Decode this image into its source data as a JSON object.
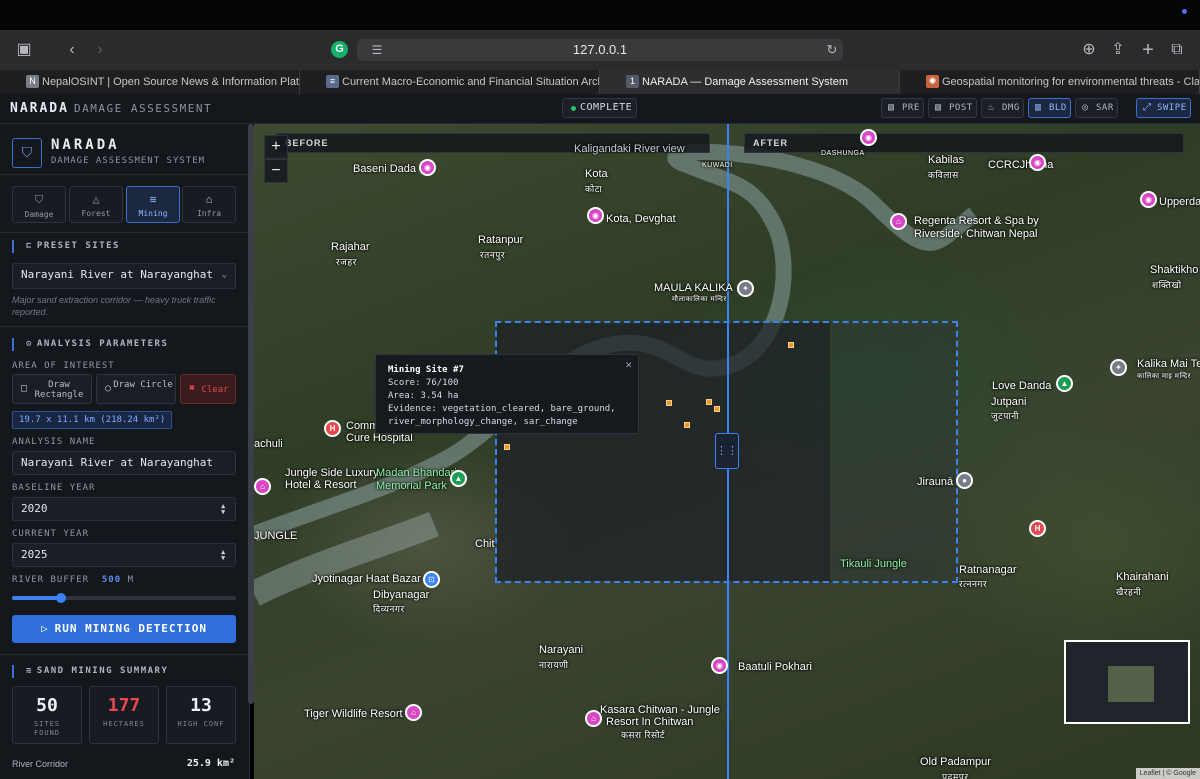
{
  "browser": {
    "url": "127.0.0.1",
    "grammarly_letter": "G",
    "tabs": [
      {
        "fav": "N",
        "title": "NepalOSINT | Open Source News & Information Platform",
        "color": "#777d86"
      },
      {
        "fav": "≡",
        "title": "Current Macro-Economic and Financial Situation Archives - th...",
        "color": "#5a6b8c"
      },
      {
        "fav": "1",
        "title": "NARADA — Damage Assessment System",
        "color": "#555b66"
      },
      {
        "fav": "✺",
        "title": "Geospatial monitoring for environmental threats - Claude",
        "color": "#c96442"
      }
    ]
  },
  "header": {
    "brand": "NARADA",
    "subtitle": "DAMAGE ASSESSMENT",
    "status": "COMPLETE",
    "layers": [
      "PRE",
      "POST",
      "DMG",
      "BLD",
      "SAR"
    ],
    "active_layer": "BLD",
    "swipe": "SWIPE"
  },
  "sidebar": {
    "title": "NARADA",
    "subtitle": "DAMAGE ASSESSMENT SYSTEM",
    "modes": [
      "Damage",
      "Forest",
      "Mining",
      "Infra"
    ],
    "active_mode": "Mining",
    "preset_title": "PRESET SITES",
    "preset_value": "Narayani River at Narayanghat",
    "preset_desc": "Major sand extraction corridor — heavy truck traffic reported.",
    "params_title": "ANALYSIS PARAMETERS",
    "aoi_label": "AREA OF INTEREST",
    "draw_rect": "Draw Rectangle",
    "draw_circle": "Draw Circle",
    "clear": "Clear",
    "aoi_size": "19.7 x 11.1 km (218.24 km²)",
    "name_label": "ANALYSIS NAME",
    "name_value": "Narayani River at Narayanghat",
    "baseline_label": "BASELINE YEAR",
    "baseline_value": "2020",
    "current_label": "CURRENT YEAR",
    "current_value": "2025",
    "buffer_label": "RIVER BUFFER",
    "buffer_value": "500",
    "buffer_unit": "M",
    "buffer_fraction": 0.22,
    "run": "RUN MINING DETECTION",
    "summary_title": "SAND MINING SUMMARY",
    "stats": [
      {
        "value": "50",
        "label": "SITES FOUND",
        "color": "#eef1f5"
      },
      {
        "value": "177",
        "label": "HECTARES",
        "color": "#e5484d"
      },
      {
        "value": "13",
        "label": "HIGH CONF",
        "color": "#eef1f5"
      }
    ],
    "corridor_label": "River Corridor",
    "corridor_value": "25.9 km²"
  },
  "map": {
    "before": "BEFORE",
    "after": "AFTER",
    "popup": {
      "title": "Mining Site #7",
      "score": "Score: 76/100",
      "area": "Area: 3.54 ha",
      "evidence": "Evidence: vegetation_cleared, bare_ground, river_morphology_change, sar_change"
    },
    "attribution": "Leaflet | © Google",
    "labels": [
      {
        "t": "Baseni Dada"
      },
      {
        "t": "Kota"
      },
      {
        "t": "कोटा"
      },
      {
        "t": "Kota, Devghat"
      },
      {
        "t": "Kaligandaki River view"
      },
      {
        "t": "KUWADI"
      },
      {
        "t": "DASHUNGA"
      },
      {
        "t": "Kabilas"
      },
      {
        "t": "कविलास"
      },
      {
        "t": "CCRCJharna"
      },
      {
        "t": "Rajahar"
      },
      {
        "t": "रजहर"
      },
      {
        "t": "Ratanpur"
      },
      {
        "t": "रतनपुर"
      },
      {
        "t": "Regenta Resort & Spa by"
      },
      {
        "t": "Riverside, Chitwan Nepal"
      },
      {
        "t": "MAULA KALIKA"
      },
      {
        "t": "मौलाकालिका मन्दिर"
      },
      {
        "t": "Shaktikho"
      },
      {
        "t": "शक्तिखो"
      },
      {
        "t": "Kalika Mai Te"
      },
      {
        "t": "कालिका माइ मन्दिर"
      },
      {
        "t": "Love Danda"
      },
      {
        "t": "Jutpani"
      },
      {
        "t": "जुटपानी"
      },
      {
        "t": "Jungle Side Luxury"
      },
      {
        "t": "Hotel & Resort"
      },
      {
        "t": "Madan Bhandari"
      },
      {
        "t": "Memorial Park"
      },
      {
        "t": "Jiraunā"
      },
      {
        "t": "JUNGLE"
      },
      {
        "t": "Jyotinagar Haat Bazar"
      },
      {
        "t": "Dibyanagar"
      },
      {
        "t": "दिव्यनगर"
      },
      {
        "t": "Tikauli Jungle"
      },
      {
        "t": "Ratnanagar"
      },
      {
        "t": "रत्ननगर"
      },
      {
        "t": "Khairahani"
      },
      {
        "t": "खैरहनी"
      },
      {
        "t": "Narayani"
      },
      {
        "t": "नारायणी"
      },
      {
        "t": "Baatuli Pokhari"
      },
      {
        "t": "Tiger Wildlife Resort"
      },
      {
        "t": "Kasara Chitwan - Jungle"
      },
      {
        "t": "Resort In Chitwan"
      },
      {
        "t": "कसरा रिसोर्ट"
      },
      {
        "t": "Old Padampur"
      },
      {
        "t": "पदमपुर"
      },
      {
        "t": "Comm"
      },
      {
        "t": "Cure Hospital"
      },
      {
        "t": "achuli"
      },
      {
        "t": "Upperda"
      },
      {
        "t": "Chit"
      }
    ]
  }
}
